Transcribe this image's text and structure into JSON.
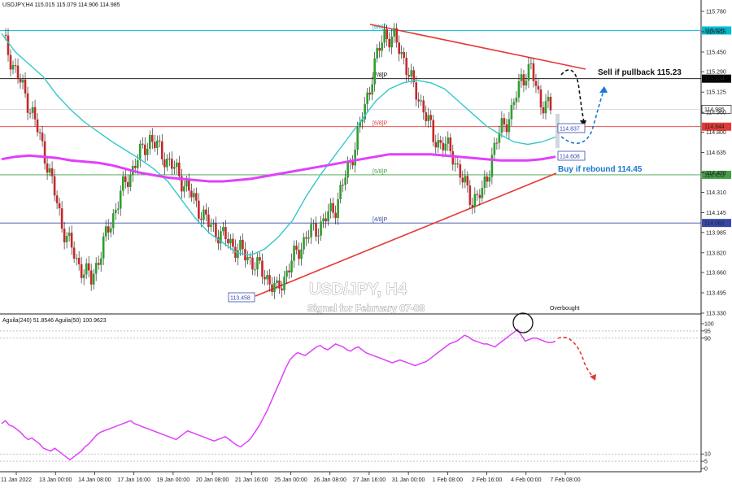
{
  "header": {
    "symbol_line": "USDJPY,H4  115.015 115.079 114.906 114.985",
    "sub_label": "Aguila(240) 51.8546  Aguila(50) 100.9623"
  },
  "watermark": {
    "title": "USD/JPY, H4",
    "subtitle": "Signal for February 07-08"
  },
  "annotations": {
    "sell": "Sell if pullback 115.23",
    "buy": "Buy if rebound 114.45",
    "overbought": "Overbought",
    "low_box": "113.458",
    "box_1": "114.837",
    "box_2": "114.608"
  },
  "murray_levels": [
    {
      "label": "8/8",
      "price": 115.625,
      "color": "#00bcd4",
      "tag": "115.625"
    },
    {
      "label": "7/8",
      "price": 115.234,
      "color": "#000000",
      "tag": "115.234"
    },
    {
      "label": "6/8",
      "price": 114.844,
      "color": "#e53935",
      "tag": "114.844"
    },
    {
      "label": "5/8",
      "price": 114.453,
      "color": "#43a047",
      "tag": "114.453"
    },
    {
      "label": "4/8",
      "price": 114.062,
      "color": "#3949ab",
      "tag": "114.062"
    }
  ],
  "price_tags": [
    {
      "price": 114.985,
      "text": "114.985",
      "bg": "#ffffff",
      "fg": "#000000"
    }
  ],
  "colors": {
    "up": "#2e9e2e",
    "down": "#c62828",
    "magenta": "#e040fb",
    "cyan": "#33c9c9",
    "trend": "#e53935"
  },
  "chart_data": [
    {
      "type": "candlestick",
      "title": "USDJPY,H4",
      "ylim": [
        113.33,
        115.78
      ],
      "y_ticks": [
        "115.780",
        "115.615",
        "115.450",
        "115.290",
        "115.125",
        "114.960",
        "114.800",
        "114.635",
        "114.470",
        "114.310",
        "114.145",
        "113.985",
        "113.820",
        "113.660",
        "113.495",
        "113.330"
      ],
      "x_ticks": [
        "11 Jan 2022",
        "13 Jan 00:00",
        "14 Jan 08:00",
        "17 Jan 16:00",
        "19 Jan 00:00",
        "20 Jan 08:00",
        "21 Jan 16:00",
        "25 Jan 00:00",
        "26 Jan 08:00",
        "27 Jan 16:00",
        "31 Jan 00:00",
        "1 Feb 08:00",
        "2 Feb 16:00",
        "4 Feb 00:00",
        "7 Feb 08:00"
      ],
      "series": [
        {
          "name": "Aguila(50)",
          "color": "#33c9c9",
          "values": [
            115.6,
            115.45,
            115.35,
            115.25,
            115.1,
            114.98,
            114.88,
            114.8,
            114.72,
            114.65,
            114.58,
            114.5,
            114.4,
            114.25,
            114.1,
            113.98,
            113.9,
            113.82,
            113.8,
            113.85,
            113.95,
            114.08,
            114.28,
            114.45,
            114.6,
            114.75,
            114.9,
            115.05,
            115.15,
            115.2,
            115.22,
            115.2,
            115.15,
            115.05,
            114.95,
            114.85,
            114.78,
            114.72,
            114.7,
            114.72,
            114.76
          ]
        },
        {
          "name": "Aguila(240)",
          "color": "#e040fb",
          "values": [
            114.58,
            114.6,
            114.61,
            114.6,
            114.59,
            114.57,
            114.56,
            114.55,
            114.53,
            114.5,
            114.47,
            114.45,
            114.43,
            114.42,
            114.41,
            114.4,
            114.4,
            114.41,
            114.42,
            114.44,
            114.46,
            114.48,
            114.5,
            114.52,
            114.54,
            114.56,
            114.58,
            114.6,
            114.62,
            114.62,
            114.62,
            114.62,
            114.61,
            114.6,
            114.59,
            114.58,
            114.57,
            114.57,
            114.57,
            114.58,
            114.6
          ]
        }
      ]
    },
    {
      "type": "line",
      "title": "Aguila(240) 51.8546  Aguila(50) 100.9623",
      "ylim": [
        0,
        100
      ],
      "y_ticks": [
        "100",
        "95",
        "90",
        "10",
        "5",
        "0"
      ],
      "series": [
        {
          "name": "Aguila(50)",
          "color": "#e040fb",
          "values": [
            31,
            33,
            30,
            29,
            27,
            25,
            22,
            20,
            21,
            19,
            17,
            14,
            13,
            12,
            14,
            12,
            10,
            8,
            6,
            8,
            10,
            12,
            15,
            17,
            20,
            23,
            25,
            26,
            27,
            28,
            29,
            30,
            31,
            32,
            33,
            31,
            30,
            29,
            28,
            27,
            26,
            25,
            24,
            23,
            22,
            21,
            20,
            22,
            24,
            26,
            25,
            24,
            23,
            22,
            21,
            20,
            19,
            20,
            21,
            22,
            20,
            18,
            16,
            15,
            17,
            19,
            22,
            26,
            30,
            35,
            40,
            46,
            52,
            58,
            64,
            70,
            75,
            78,
            80,
            79,
            78,
            80,
            82,
            84,
            85,
            83,
            82,
            84,
            86,
            85,
            84,
            82,
            81,
            83,
            84,
            82,
            80,
            79,
            78,
            77,
            76,
            75,
            74,
            73,
            74,
            75,
            74,
            73,
            72,
            71,
            72,
            73,
            74,
            76,
            78,
            80,
            82,
            84,
            86,
            87,
            88,
            90,
            92,
            91,
            89,
            88,
            87,
            86,
            86,
            85,
            84,
            86,
            88,
            90,
            92,
            94,
            96,
            92,
            88,
            89,
            90,
            90,
            89,
            88,
            87,
            87,
            88
          ]
        }
      ]
    }
  ]
}
